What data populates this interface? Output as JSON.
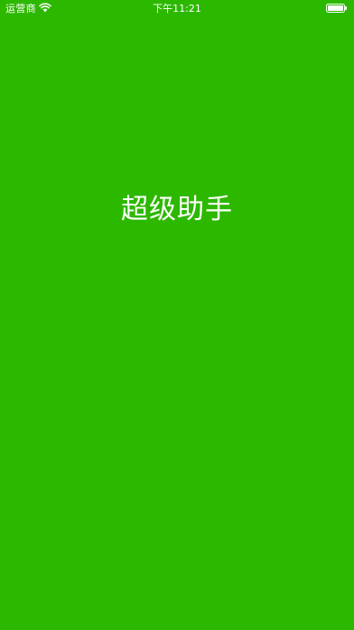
{
  "status_bar": {
    "carrier": "运营商",
    "time": "下午11:21",
    "wifi_icon": "wifi-icon",
    "battery_icon": "battery-icon",
    "battery_level": 1.0
  },
  "splash": {
    "title": "超级助手"
  },
  "colors": {
    "background": "#2DB800",
    "text": "#FFFFFF"
  }
}
